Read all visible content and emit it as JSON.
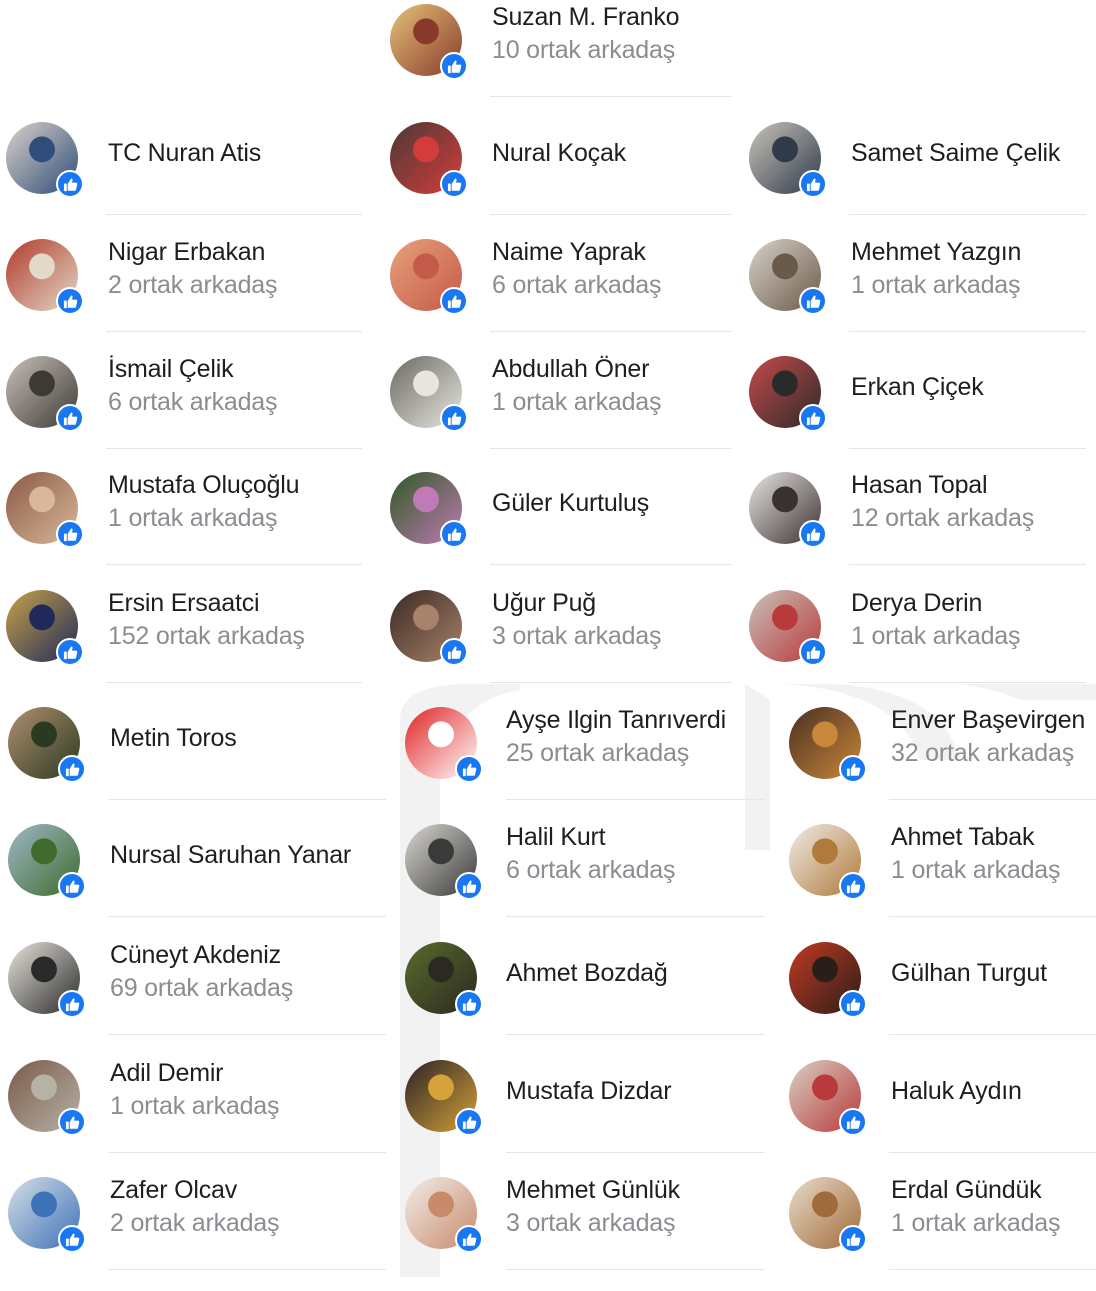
{
  "columns": [
    [
      {
        "name": "TC Nuran Atis",
        "mutual": "",
        "colors": [
          "#d9d2c9",
          "#2f4d7a"
        ]
      },
      {
        "name": "Nigar Erbakan",
        "mutual": "2 ortak arkadaş",
        "colors": [
          "#b03a2a",
          "#e3d9c8"
        ]
      },
      {
        "name": "İsmail Çelik",
        "mutual": "6 ortak arkadaş",
        "colors": [
          "#c9c1b8",
          "#3d3a35"
        ]
      },
      {
        "name": "Mustafa Oluçoğlu",
        "mutual": "1 ortak arkadaş",
        "colors": [
          "#8a5a44",
          "#d9b89a"
        ]
      },
      {
        "name": "Ersin Ersaatci",
        "mutual": "152 ortak arkadaş",
        "colors": [
          "#c7a24a",
          "#1f2a5a"
        ]
      },
      {
        "name": "Metin Toros",
        "mutual": "",
        "colors": [
          "#b08f6e",
          "#2a3a22"
        ]
      },
      {
        "name": "Nursal Saruhan Yanar",
        "mutual": "",
        "colors": [
          "#9fb7c8",
          "#3f6b2d"
        ]
      },
      {
        "name": "Cüneyt Akdeniz",
        "mutual": "69 ortak arkadaş",
        "colors": [
          "#e8e4dc",
          "#2a2a2a"
        ]
      },
      {
        "name": "Adil Demir",
        "mutual": "1 ortak arkadaş",
        "colors": [
          "#7a5a4a",
          "#b7b2a6"
        ]
      },
      {
        "name": "Zafer Olcav",
        "mutual": "2 ortak arkadaş",
        "colors": [
          "#d6dfe6",
          "#3c72b8"
        ]
      }
    ],
    [
      {
        "name": "Suzan M. Franko",
        "mutual": "10 ortak arkadaş",
        "colors": [
          "#e2c27a",
          "#8a3a2a"
        ]
      },
      {
        "name": "Nural Koçak",
        "mutual": "",
        "colors": [
          "#4a3a35",
          "#d43c3c"
        ]
      },
      {
        "name": "Naime Yaprak",
        "mutual": "6 ortak arkadaş",
        "colors": [
          "#e6a07a",
          "#c65a4a"
        ]
      },
      {
        "name": "Abdullah Öner",
        "mutual": "1 ortak arkadaş",
        "colors": [
          "#6a6a62",
          "#e8e6e0"
        ]
      },
      {
        "name": "Güler Kurtuluş",
        "mutual": "",
        "colors": [
          "#2e5a22",
          "#c07ab6"
        ]
      },
      {
        "name": "Uğur Puğ",
        "mutual": "3 ortak arkadaş",
        "colors": [
          "#3a2a22",
          "#a8826a"
        ]
      },
      {
        "name": "Ayşe Ilgin Tanrıverdi",
        "mutual": "25 ortak arkadaş",
        "colors": [
          "#e02424",
          "#ffffff"
        ]
      },
      {
        "name": "Halil Kurt",
        "mutual": "6 ortak arkadaş",
        "colors": [
          "#d9d6d0",
          "#3a3a3a"
        ]
      },
      {
        "name": "Ahmet Bozdağ",
        "mutual": "",
        "colors": [
          "#5a6a2a",
          "#2a2a22"
        ]
      },
      {
        "name": "Mustafa Dizdar",
        "mutual": "",
        "colors": [
          "#2a2224",
          "#d6a23a"
        ]
      },
      {
        "name": "Mehmet Günlük",
        "mutual": "3 ortak arkadaş",
        "colors": [
          "#f0eeea",
          "#c98a6a"
        ]
      }
    ],
    [
      {
        "name": "Samet Saime Çelik",
        "mutual": "",
        "colors": [
          "#c9c4bb",
          "#2f3a4a"
        ]
      },
      {
        "name": "Mehmet Yazgın",
        "mutual": "1 ortak arkadaş",
        "colors": [
          "#d8d2c8",
          "#6a5a4a"
        ]
      },
      {
        "name": "Erkan Çiçek",
        "mutual": "",
        "colors": [
          "#c84a4a",
          "#2a2a2a"
        ]
      },
      {
        "name": "Hasan Topal",
        "mutual": "12 ortak arkadaş",
        "colors": [
          "#e8e6e2",
          "#3a3030"
        ]
      },
      {
        "name": "Derya Derin",
        "mutual": "1 ortak arkadaş",
        "colors": [
          "#c9c2ba",
          "#b83a3a"
        ]
      },
      {
        "name": "Enver Başevirgen",
        "mutual": "32 ortak arkadaş",
        "colors": [
          "#4a3022",
          "#c8873a"
        ]
      },
      {
        "name": "Ahmet Tabak",
        "mutual": "1 ortak arkadaş",
        "colors": [
          "#efece6",
          "#b07a3a"
        ]
      },
      {
        "name": "Gülhan Turgut",
        "mutual": "",
        "colors": [
          "#c23a22",
          "#2a1e1a"
        ]
      },
      {
        "name": "Haluk Aydın",
        "mutual": "",
        "colors": [
          "#d8d0c4",
          "#b83a3a"
        ]
      },
      {
        "name": "Erdal Gündük",
        "mutual": "1 ortak arkadaş",
        "colors": [
          "#e8dcc8",
          "#a06a3a"
        ]
      }
    ]
  ],
  "like_badge_icon": "thumbs-up-icon",
  "like_badge_color": "#1877f2"
}
